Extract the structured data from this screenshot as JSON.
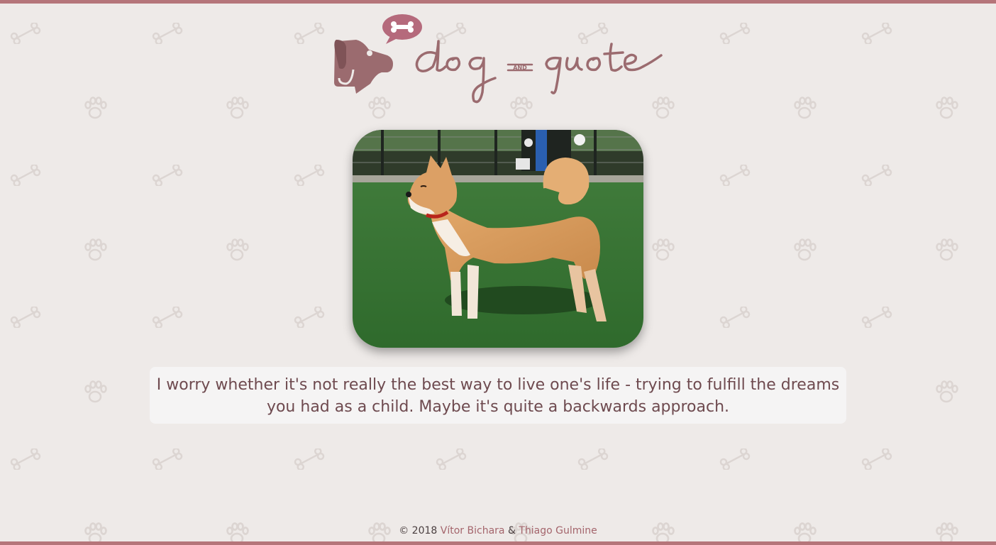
{
  "brand": {
    "word_left": "dog",
    "word_mid": "AND",
    "word_right": "quote",
    "color": "#9b6b6f"
  },
  "photo": {
    "icon": "shiba-inu-dog-photo"
  },
  "quote": {
    "text": "I worry whether it's not really the best way to live one's life - trying to fulfill the dreams you had as a child. Maybe it's quite a backwards approach."
  },
  "footer": {
    "copyright": "© 2018",
    "author1": "Vítor Bichara",
    "separator": "&",
    "author2": "Thiago Gulmine"
  },
  "background": {
    "color": "#eeeae8",
    "accent": "#b5757a",
    "pattern_icons": [
      "bone-icon",
      "paw-icon"
    ]
  }
}
